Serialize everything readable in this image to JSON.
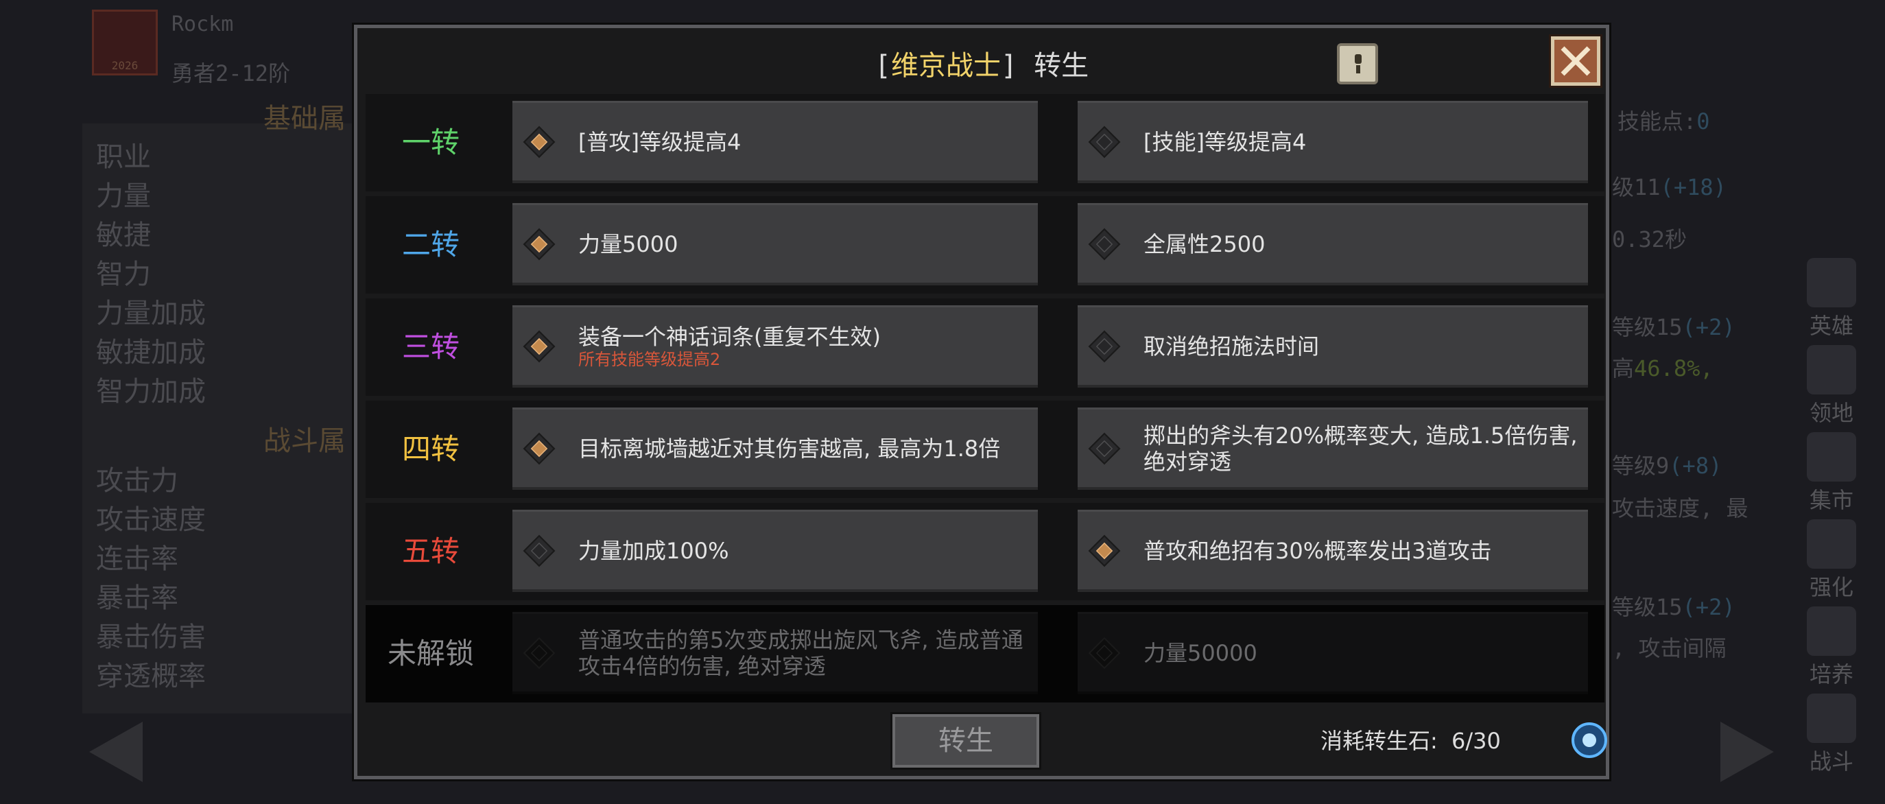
{
  "background": {
    "player_name": "Rockm",
    "player_rank": "勇者2-12阶",
    "avatar_badge": "2026",
    "section_basic": "基础属",
    "section_combat": "战斗属",
    "basic_stats": [
      "职业",
      "力量",
      "敏捷",
      "智力",
      "力量加成",
      "敏捷加成",
      "智力加成"
    ],
    "combat_stats": [
      "攻击力",
      "攻击速度",
      "连击率",
      "暴击率",
      "暴击伤害",
      "穿透概率"
    ],
    "skill_points_label": "技能点:",
    "skill_points_value": "0",
    "right_snippets": [
      {
        "text": "级11",
        "extra": "(+18)"
      },
      {
        "text": "0.32秒",
        "extra": ""
      },
      {
        "text": "等级15",
        "extra": "(+2)"
      },
      {
        "text": "高",
        "extra": "46.8%,"
      },
      {
        "text": "等级9",
        "extra": "(+8)"
      },
      {
        "text": "攻击速度, 最",
        "extra": ""
      },
      {
        "text": "等级15",
        "extra": "(+2)"
      },
      {
        "text": ", 攻击间隔",
        "extra": ""
      }
    ],
    "side_menu": [
      "英雄",
      "领地",
      "集市",
      "强化",
      "培养",
      "战斗"
    ]
  },
  "modal": {
    "title_prefix": "[",
    "hero_name": "维京战士",
    "title_suffix": "] 转生",
    "rows": [
      {
        "label": "一转",
        "color": "#5fd36a",
        "locked": false,
        "left": {
          "text": "[普攻]等级提高4",
          "note": "",
          "active": true
        },
        "right": {
          "text": "[技能]等级提高4",
          "note": "",
          "active": false
        }
      },
      {
        "label": "二转",
        "color": "#4fa6e8",
        "locked": false,
        "left": {
          "text": "力量5000",
          "note": "",
          "active": true
        },
        "right": {
          "text": "全属性2500",
          "note": "",
          "active": false
        }
      },
      {
        "label": "三转",
        "color": "#c04fe0",
        "locked": false,
        "left": {
          "text": "装备一个神话词条(重复不生效)",
          "note": "所有技能等级提高2",
          "active": true
        },
        "right": {
          "text": "取消绝招施法时间",
          "note": "",
          "active": false
        }
      },
      {
        "label": "四转",
        "color": "#f0c040",
        "locked": false,
        "left": {
          "text": "目标离城墙越近对其伤害越高, 最高为1.8倍",
          "note": "",
          "active": true
        },
        "right": {
          "text": "掷出的斧头有20%概率变大, 造成1.5倍伤害, 绝对穿透",
          "note": "",
          "active": false
        }
      },
      {
        "label": "五转",
        "color": "#e84a3a",
        "locked": false,
        "left": {
          "text": "力量加成100%",
          "note": "",
          "active": false
        },
        "right": {
          "text": "普攻和绝招有30%概率发出3道攻击",
          "note": "",
          "active": true
        }
      },
      {
        "label": "未解锁",
        "color": "#8a8a8c",
        "locked": true,
        "left": {
          "text": "普通攻击的第5次变成掷出旋风飞斧, 造成普通攻击4倍的伤害, 绝对穿透",
          "note": "",
          "active": false
        },
        "right": {
          "text": "力量50000",
          "note": "",
          "active": false
        }
      }
    ],
    "rebirth_button": "转生",
    "cost_label": "消耗转生石:",
    "cost_value": "6/30"
  }
}
